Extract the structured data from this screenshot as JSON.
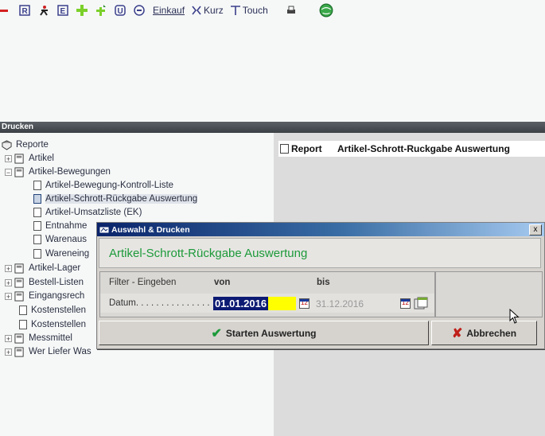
{
  "toolbar": {
    "einkauf": "Einkauf",
    "kurz": "Kurz",
    "touch": "Touch"
  },
  "section_title": "Drucken",
  "tree": {
    "root": "Reporte",
    "items": [
      {
        "label": "Artikel"
      },
      {
        "label": "Artikel-Bewegungen"
      },
      {
        "label": "Artikel-Bewegung-Kontroll-Liste"
      },
      {
        "label": "Artikel-Schrott-Rückgabe Auswertung"
      },
      {
        "label": "Artikel-Umsatzliste (EK)"
      },
      {
        "label": "Entnahme"
      },
      {
        "label": "Warenaus"
      },
      {
        "label": "Wareneing"
      },
      {
        "label": "Artikel-Lager"
      },
      {
        "label": "Bestell-Listen"
      },
      {
        "label": "Eingangsrech"
      },
      {
        "label": "Kostenstellen"
      },
      {
        "label": "Kostenstellen"
      },
      {
        "label": "Messmittel"
      },
      {
        "label": "Wer Liefer Was"
      }
    ]
  },
  "report_panel": {
    "label": "Report",
    "value": "Artikel-Schrott-Ruckgabe Auswertung"
  },
  "dialog": {
    "title": "Auswahl & Drucken",
    "close": "x",
    "heading": "Artikel-Schrott-Rückgabe Auswertung",
    "filter_label": "Filter - Eingeben",
    "von_label": "von",
    "bis_label": "bis",
    "datum_label": "Datum. . . . . . . . . . . . . . .",
    "date_from": "01.01.2016",
    "date_to": "31.12.2016",
    "start_button": "Starten Auswertung",
    "cancel_button": "Abbrechen"
  },
  "colors": {
    "accent_green": "#1d9a3a",
    "title_blue": "#0a246a",
    "highlight_yellow": "#ffff00"
  }
}
